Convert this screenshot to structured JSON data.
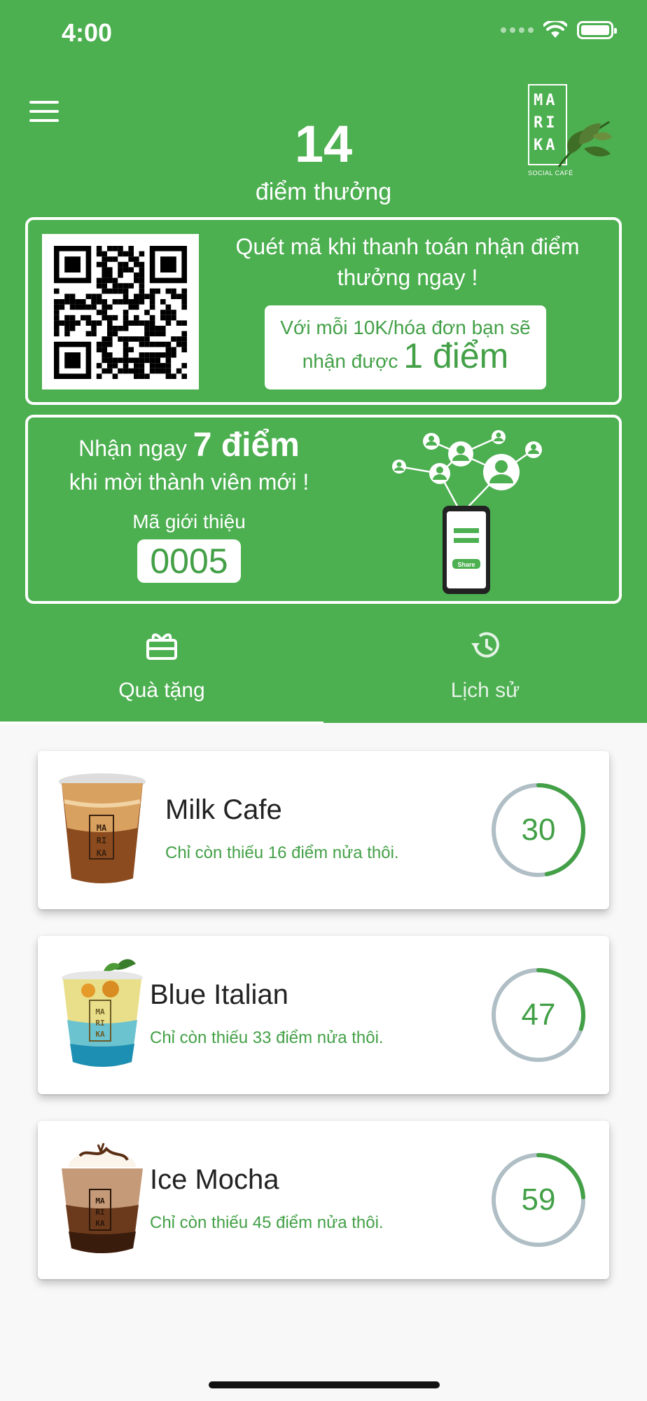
{
  "status_bar": {
    "time": "4:00"
  },
  "header": {
    "points": "14",
    "points_label": "điểm thưởng",
    "logo_letters": [
      "MA",
      "RI",
      "KA"
    ],
    "logo_tagline": "SOCIAL CAFÉ"
  },
  "qr_card": {
    "instruction": "Quét mã khi thanh toán nhận điểm thưởng ngay !",
    "info_line1": "Với mỗi 10K/hóa đơn bạn sẽ",
    "info_line2_prefix": "nhận được",
    "info_line2_highlight": "1 điểm"
  },
  "invite_card": {
    "line1_prefix": "Nhận ngay",
    "line1_highlight": "7 điểm",
    "line2": "khi mời thành viên mới !",
    "code_label": "Mã giới thiệu",
    "code": "0005",
    "share_label": "Share"
  },
  "tabs": [
    {
      "label": "Quà tặng",
      "icon": "gift-icon",
      "active": true
    },
    {
      "label": "Lịch sử",
      "icon": "history-icon",
      "active": false
    }
  ],
  "gifts": [
    {
      "name": "Milk Cafe",
      "note": "Chỉ còn thiếu 16 điểm nửa thôi.",
      "required": "30",
      "progress": 0.47
    },
    {
      "name": "Blue Italian",
      "note": "Chỉ còn thiếu 33 điểm nửa thôi.",
      "required": "47",
      "progress": 0.3
    },
    {
      "name": "Ice Mocha",
      "note": "Chỉ còn thiếu 45 điểm nửa thôi.",
      "required": "59",
      "progress": 0.24
    }
  ],
  "colors": {
    "brand_green": "#4caf50",
    "text_green": "#43a047",
    "ring_track": "#b0bec5"
  }
}
